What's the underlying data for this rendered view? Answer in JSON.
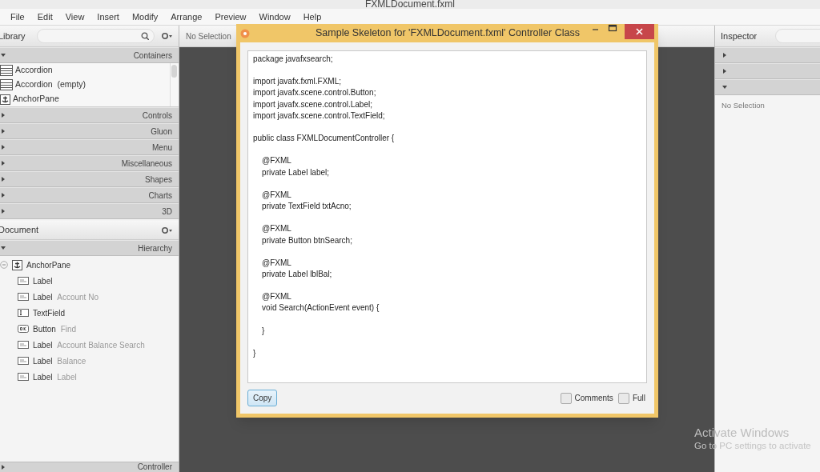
{
  "window": {
    "title": "FXMLDocument.fxml"
  },
  "menu": [
    "File",
    "Edit",
    "View",
    "Insert",
    "Modify",
    "Arrange",
    "Preview",
    "Window",
    "Help"
  ],
  "library": {
    "title": "Library",
    "sections": [
      {
        "label": "Containers",
        "expanded": true,
        "items": [
          {
            "label": "Accordion",
            "kind": "accordion"
          },
          {
            "label": "Accordion  (empty)",
            "kind": "accordion"
          },
          {
            "label": "AnchorPane",
            "kind": "anchor"
          }
        ]
      },
      {
        "label": "Controls",
        "expanded": false
      },
      {
        "label": "Gluon",
        "expanded": false
      },
      {
        "label": "Menu",
        "expanded": false
      },
      {
        "label": "Miscellaneous",
        "expanded": false
      },
      {
        "label": "Shapes",
        "expanded": false
      },
      {
        "label": "Charts",
        "expanded": false
      },
      {
        "label": "3D",
        "expanded": false
      }
    ]
  },
  "document": {
    "title": "Document",
    "section": "Hierarchy",
    "tree": [
      {
        "type": "AnchorPane",
        "kind": "anchor",
        "expanded": true,
        "children": [
          {
            "type": "Label",
            "kind": "label"
          },
          {
            "type": "Label",
            "text": "Account No",
            "kind": "label"
          },
          {
            "type": "TextField",
            "kind": "textfield"
          },
          {
            "type": "Button",
            "text": "Find",
            "kind": "button"
          },
          {
            "type": "Label",
            "text": "Account Balance Search",
            "kind": "label"
          },
          {
            "type": "Label",
            "text": "Balance",
            "kind": "label"
          },
          {
            "type": "Label",
            "text": "Label",
            "kind": "label"
          }
        ]
      }
    ],
    "footer": "Controller"
  },
  "canvas": {
    "selection": "No Selection"
  },
  "inspector": {
    "title": "Inspector",
    "sections": [
      {
        "expanded": false
      },
      {
        "expanded": false
      },
      {
        "expanded": true
      }
    ],
    "empty": "No Selection"
  },
  "dialog": {
    "title": "Sample Skeleton for 'FXMLDocument.fxml' Controller Class",
    "code": "package javafxsearch;\n\nimport javafx.fxml.FXML;\nimport javafx.scene.control.Button;\nimport javafx.scene.control.Label;\nimport javafx.scene.control.TextField;\n\npublic class FXMLDocumentController {\n\n    @FXML\n    private Label label;\n\n    @FXML\n    private TextField txtAcno;\n\n    @FXML\n    private Button btnSearch;\n\n    @FXML\n    private Label lblBal;\n\n    @FXML\n    void Search(ActionEvent event) {\n\n    }\n\n}",
    "button": "Copy",
    "options": [
      {
        "label": "Comments",
        "checked": false
      },
      {
        "label": "Full",
        "checked": false
      }
    ]
  },
  "os_notice": {
    "title": "Activate Windows",
    "subtitle": "Go to PC settings to activate"
  }
}
